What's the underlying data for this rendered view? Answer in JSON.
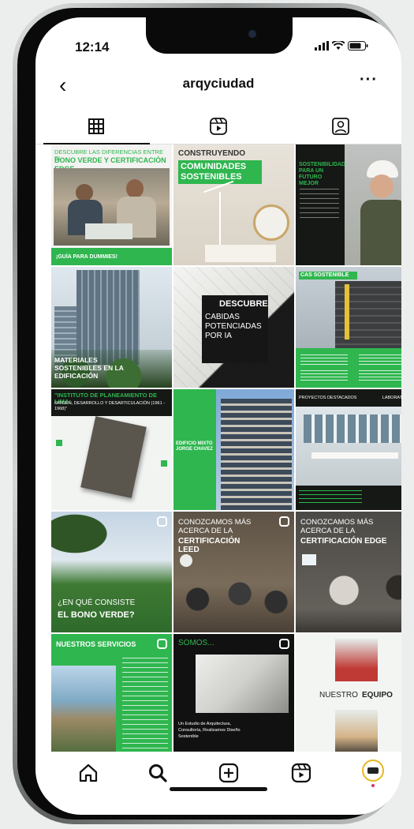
{
  "status": {
    "time": "12:14"
  },
  "header": {
    "username": "arqyciudad",
    "back": "‹",
    "more": "···"
  },
  "posts": [
    {
      "title": "DESCUBRE LAS DIFERENCIAS ENTRE EL",
      "headline": "BONO VERDE Y CERTIFICACIÓN EDGE.",
      "footer": "¡GUÍA PARA DUMMIES!"
    },
    {
      "kicker": "CONSTRUYENDO",
      "headline": "COMUNIDADES SOSTENIBLES"
    },
    {
      "headline": "SOSTENIBILIDAD PARA UN FUTURO MEJOR"
    },
    {
      "caption": "MATERIALES SOSTENIBLES EN LA EDIFICACIÓN"
    },
    {
      "headline": "DESCUBRE",
      "sub": "CABIDAS POTENCIADAS POR IA"
    },
    {
      "headline": "CAS SOSTENIBLE"
    },
    {
      "headline": "\"INSTITUTO DE PLANEAMIENTO DE LIMA:",
      "sub": "ORIGEN, DESARROLLO Y DESARTICULACIÓN (1961 - 1968)\""
    },
    {
      "headline": "EDIFICIO MIXTO JORGE CHAVEZ"
    },
    {
      "headline": "PROYECTOS DESTACADOS",
      "sub": "LABORATORIO"
    },
    {
      "headline": "¿EN QUÉ CONSISTE",
      "sub": "EL BONO VERDE?"
    },
    {
      "kicker": "CONOZCAMOS MÁS ACERCA DE LA",
      "headline": "CERTIFICACIÓN LEED"
    },
    {
      "kicker": "CONOZCAMOS MÁS ACERCA DE LA",
      "headline": "CERTIFICACIÓN EDGE"
    },
    {
      "headline": "NUESTROS SERVICIOS"
    },
    {
      "headline": "SOMOS...",
      "sub": "Un Estudio de Arquitectura, Consultoría, Realizamos Diseño Sostenible"
    },
    {
      "headline": "NUESTRO",
      "bold": "EQUIPO"
    }
  ],
  "colors": {
    "brand_green": "#2fb64f",
    "dark": "#111111"
  }
}
